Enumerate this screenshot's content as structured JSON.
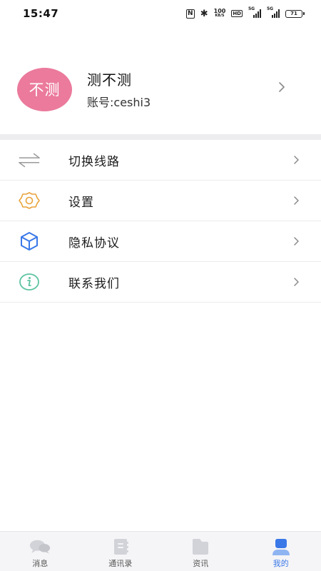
{
  "status_bar": {
    "time": "15:47",
    "nfc": "N",
    "bluetooth": "✱",
    "net_speed_value": "100",
    "net_speed_unit": "KB/S",
    "hd": "HD",
    "sim1_type": "5G",
    "sim2_type": "5G",
    "battery": "71"
  },
  "profile": {
    "avatar_text": "不测",
    "avatar_color": "#eb7a9c",
    "name": "测不测",
    "account": "账号:ceshi3"
  },
  "menu": {
    "items": [
      {
        "label": "切换线路",
        "icon": "swap-arrows-icon"
      },
      {
        "label": "设置",
        "icon": "gear-icon"
      },
      {
        "label": "隐私协议",
        "icon": "cube-icon"
      },
      {
        "label": "联系我们",
        "icon": "info-icon"
      }
    ]
  },
  "bottom_nav": {
    "items": [
      {
        "label": "消息",
        "icon": "chat-bubbles-icon",
        "active": false
      },
      {
        "label": "通讯录",
        "icon": "contacts-book-icon",
        "active": false
      },
      {
        "label": "资讯",
        "icon": "folder-icon",
        "active": false
      },
      {
        "label": "我的",
        "icon": "user-icon",
        "active": true
      }
    ],
    "active_color": "#3a78e8",
    "inactive_color": "#d2d3d8"
  }
}
